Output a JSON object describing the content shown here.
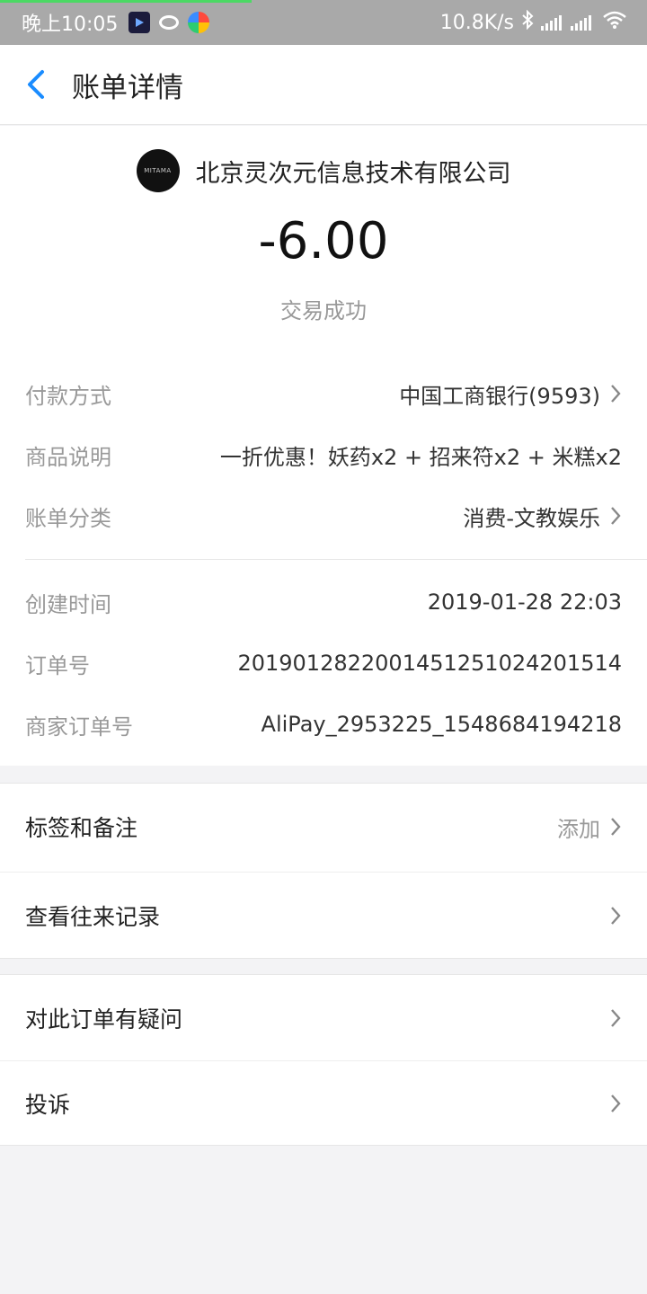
{
  "status_bar": {
    "time": "晚上10:05",
    "speed": "10.8K/s"
  },
  "header": {
    "title": "账单详情"
  },
  "merchant": {
    "logo_text": "MITAMA",
    "name": "北京灵次元信息技术有限公司"
  },
  "transaction": {
    "amount": "-6.00",
    "status": "交易成功"
  },
  "info": {
    "payment_method_label": "付款方式",
    "payment_method_value": "中国工商银行(9593)",
    "product_desc_label": "商品说明",
    "product_desc_value": "一折优惠！妖药x2 + 招来符x2 + 米糕x2",
    "category_label": "账单分类",
    "category_value": "消费-文教娱乐",
    "created_label": "创建时间",
    "created_value": "2019-01-28 22:03",
    "order_no_label": "订单号",
    "order_no_value": "20190128220014512510242015​14",
    "merchant_order_label": "商家订单号",
    "merchant_order_value": "AliPay_2953225_1548684194218"
  },
  "actions": {
    "tags_label": "标签和备注",
    "tags_action": "添加",
    "history_label": "查看往来记录",
    "question_label": "对此订单有疑问",
    "complaint_label": "投诉"
  },
  "colors": {
    "accent": "#1a8cff",
    "progress": "#4cd964",
    "statusbar": "#a9a9a9"
  }
}
